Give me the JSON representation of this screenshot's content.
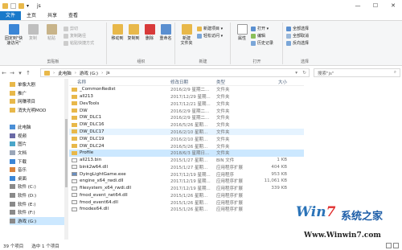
{
  "window": {
    "title": "js"
  },
  "tabs": [
    "文件",
    "主页",
    "共享",
    "查看"
  ],
  "ribbon": {
    "clipboard": {
      "group": "剪贴板",
      "pin": "固定到\"快速访问\"",
      "copy": "复制",
      "paste": "粘贴",
      "cut": "剪切",
      "copy_path": "复制路径",
      "paste_shortcut": "粘贴快捷方式"
    },
    "organize": {
      "group": "组织",
      "move_to": "移动到",
      "copy_to": "复制到",
      "delete": "删除",
      "rename": "重命名"
    },
    "new": {
      "group": "新建",
      "new_folder": "新建\n文件夹",
      "new_item": "新建项目 ▾",
      "easy_access": "轻松访问 ▾"
    },
    "open": {
      "group": "打开",
      "properties": "属性",
      "open": "打开 ▾",
      "edit": "编辑",
      "history": "历史记录"
    },
    "select": {
      "group": "选择",
      "select_all": "全部选择",
      "select_none": "全部取消",
      "invert": "反向选择"
    }
  },
  "address": {
    "path": [
      "此电脑",
      "游戏 (G:)",
      "js"
    ],
    "search_placeholder": "搜索\"js\""
  },
  "nav": [
    {
      "label": "单像大剧",
      "icon": "folder-icon"
    },
    {
      "label": "推广",
      "icon": "folder-icon"
    },
    {
      "label": "网赚项目",
      "icon": "folder-icon"
    },
    {
      "label": "消失光明MOD",
      "icon": "folder-icon"
    },
    {
      "label": "",
      "icon": ""
    },
    {
      "label": "此电脑",
      "icon": "computer-icon"
    },
    {
      "label": "视频",
      "icon": "video-icon"
    },
    {
      "label": "图片",
      "icon": "picture-icon"
    },
    {
      "label": "文档",
      "icon": "document-icon"
    },
    {
      "label": "下载",
      "icon": "download-icon"
    },
    {
      "label": "音乐",
      "icon": "music-icon"
    },
    {
      "label": "桌面",
      "icon": "desktop-icon"
    },
    {
      "label": "软件 (C:)",
      "icon": "drive-icon"
    },
    {
      "label": "软件 (D:)",
      "icon": "drive-icon"
    },
    {
      "label": "软件 (E:)",
      "icon": "drive-icon"
    },
    {
      "label": "软件 (F:)",
      "icon": "drive-icon"
    },
    {
      "label": "游戏 (G:)",
      "icon": "drive-icon"
    }
  ],
  "columns": {
    "name": "名称",
    "date": "修改日期",
    "type": "类型",
    "size": "大小"
  },
  "files": [
    {
      "name": "_CommonRedist",
      "date": "2016/2/9 星期二...",
      "type": "文件夹",
      "size": "",
      "kind": "folder"
    },
    {
      "name": "all213",
      "date": "2017/12/29 星期...",
      "type": "文件夹",
      "size": "",
      "kind": "folder"
    },
    {
      "name": "DevTools",
      "date": "2017/12/21 星期...",
      "type": "文件夹",
      "size": "",
      "kind": "folder"
    },
    {
      "name": "DW",
      "date": "2016/2/9 星期二...",
      "type": "文件夹",
      "size": "",
      "kind": "folder"
    },
    {
      "name": "DW_DLC1",
      "date": "2016/2/9 星期二...",
      "type": "文件夹",
      "size": "",
      "kind": "folder"
    },
    {
      "name": "DW_DLC16",
      "date": "2016/5/26 星期...",
      "type": "文件夹",
      "size": "",
      "kind": "folder"
    },
    {
      "name": "DW_DLC17",
      "date": "2016/2/10 星期...",
      "type": "文件夹",
      "size": "",
      "kind": "folder"
    },
    {
      "name": "DW_DLC19",
      "date": "2016/2/10 星期...",
      "type": "文件夹",
      "size": "",
      "kind": "folder"
    },
    {
      "name": "DW_DLC24",
      "date": "2016/5/26 星期...",
      "type": "文件夹",
      "size": "",
      "kind": "folder"
    },
    {
      "name": "Profile",
      "date": "2018/6/3 星期日...",
      "type": "文件夹",
      "size": "",
      "kind": "folder"
    },
    {
      "name": "all213.bin",
      "date": "2015/1/27 星期...",
      "type": "BIN 文件",
      "size": "1 KB",
      "kind": "file"
    },
    {
      "name": "bink2w64.dll",
      "date": "2015/1/27 星期...",
      "type": "应用程序扩展",
      "size": "404 KB",
      "kind": "dll"
    },
    {
      "name": "DyingLightGame.exe",
      "date": "2017/12/19 星期...",
      "type": "应用程序",
      "size": "953 KB",
      "kind": "exe"
    },
    {
      "name": "engine_x64_rwdi.dll",
      "date": "2017/12/19 星期...",
      "type": "应用程序扩展",
      "size": "11,061 KB",
      "kind": "dll"
    },
    {
      "name": "filesystem_x64_rwdi.dll",
      "date": "2017/12/19 星期...",
      "type": "应用程序扩展",
      "size": "339 KB",
      "kind": "dll"
    },
    {
      "name": "fmod_event_net64.dll",
      "date": "2015/1/26 星期...",
      "type": "应用程序扩展",
      "size": "",
      "kind": "dll"
    },
    {
      "name": "fmod_event64.dll",
      "date": "2015/1/26 星期...",
      "type": "应用程序扩展",
      "size": "",
      "kind": "dll"
    },
    {
      "name": "fmodex64.dll",
      "date": "2015/1/26 星期...",
      "type": "应用程序扩展",
      "size": "",
      "kind": "dll"
    }
  ],
  "highlighted_row": 6,
  "selected_row": 9,
  "status": {
    "count": "39 个项目",
    "selected": "选中 1 个项目"
  },
  "watermark": {
    "logo_a": "Win",
    "logo_b": "7",
    "cn": "系统之家",
    "url": "Www.Winwin7.com"
  },
  "colors": {
    "accent": "#1979ca",
    "folder": "#e8b84a",
    "selection": "#cce8ff",
    "hover": "#e5f3ff"
  }
}
